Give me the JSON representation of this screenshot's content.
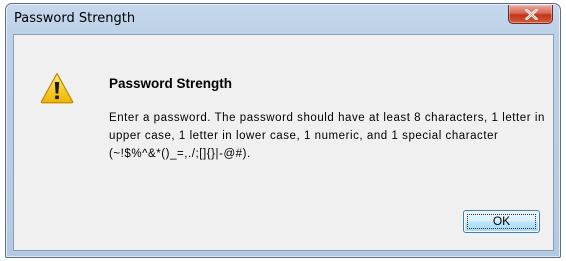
{
  "window": {
    "title": "Password Strength"
  },
  "titlebar": {
    "close_icon": "close-x-icon"
  },
  "dialog": {
    "icon": "warning-triangle-icon",
    "heading": "Password Strength",
    "message": "Enter a password. The password should have at least 8 characters, 1 letter in upper case, 1 letter in lower case, 1 numeric, and 1 special character (~!$%^&*()_=,./;[]{}|-@#).",
    "ok_label": "OK"
  },
  "colors": {
    "close_button": "#c2351a",
    "warning_fill": "#f5c400",
    "client_background": "#f0f0f0",
    "frame": "#bdd1e8"
  }
}
